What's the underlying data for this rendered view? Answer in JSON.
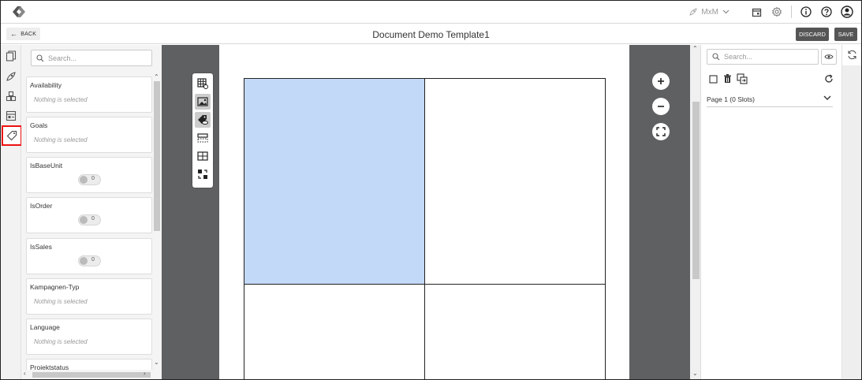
{
  "header": {
    "project_label": "MxM"
  },
  "toolbar": {
    "back_label": "BACK",
    "document_title": "Document Demo Template1",
    "discard_label": "DISCARD",
    "save_label": "SAVE"
  },
  "filter_panel": {
    "search_placeholder": "Search...",
    "items": [
      {
        "label": "Availability",
        "kind": "select",
        "value": "Nothing is selected"
      },
      {
        "label": "Goals",
        "kind": "select",
        "value": "Nothing is selected"
      },
      {
        "label": "IsBaseUnit",
        "kind": "toggle",
        "value": "0"
      },
      {
        "label": "IsOrder",
        "kind": "toggle",
        "value": "0"
      },
      {
        "label": "IsSales",
        "kind": "toggle",
        "value": "0"
      },
      {
        "label": "Kampagnen-Typ",
        "kind": "select",
        "value": "Nothing is selected"
      },
      {
        "label": "Language",
        "kind": "select",
        "value": "Nothing is selected"
      },
      {
        "label": "Projektstatus",
        "kind": "select",
        "value": ""
      }
    ]
  },
  "right_panel": {
    "search_placeholder": "Search...",
    "page_label": "Page 1 (0 Slots)"
  },
  "colors": {
    "selected_slot": "#c2d9f7",
    "canvas_bg": "#5f6062",
    "active_rail_border": "#e11111",
    "button_dark": "#555555"
  }
}
